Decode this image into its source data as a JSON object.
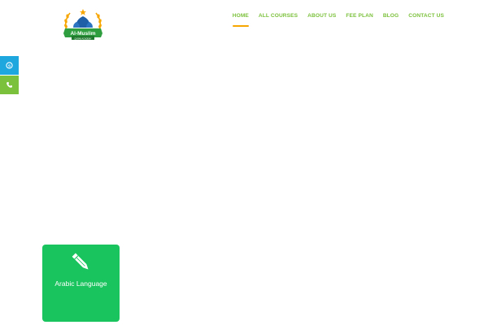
{
  "brand": {
    "logo_text": "Al-Muslim",
    "logo_subtext": "QURAN ACADEMY",
    "colors": {
      "primary_green": "#7cc13c",
      "accent_orange": "#f7a600",
      "card_green": "#19c35d",
      "skype_blue": "#1ea6df"
    }
  },
  "nav": {
    "items": [
      {
        "label": "HOME",
        "active": true
      },
      {
        "label": "ALL COURSES",
        "active": false
      },
      {
        "label": "ABOUT US",
        "active": false
      },
      {
        "label": "FEE PLAN",
        "active": false
      },
      {
        "label": "BLOG",
        "active": false
      },
      {
        "label": "CONTACT US",
        "active": false
      }
    ]
  },
  "side_buttons": [
    {
      "icon": "skype-icon"
    },
    {
      "icon": "phone-icon"
    }
  ],
  "course_card": {
    "icon": "pencil-icon",
    "label": "Arabic Language"
  }
}
